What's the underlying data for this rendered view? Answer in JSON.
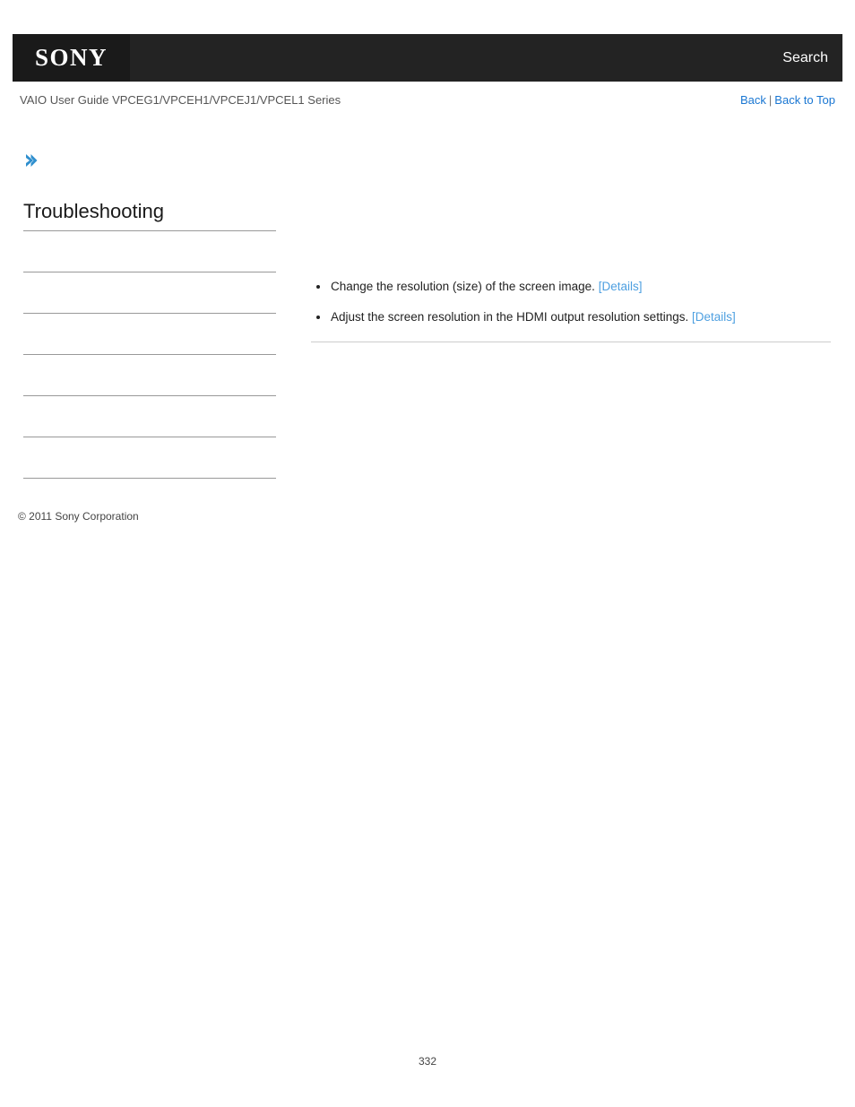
{
  "header": {
    "logo_text": "SONY",
    "search_label": "Search"
  },
  "subheader": {
    "guide_title": "VAIO User Guide VPCEG1/VPCEH1/VPCEJ1/VPCEL1 Series",
    "back_label": "Back",
    "separator": "|",
    "back_to_top_label": "Back to Top"
  },
  "sidebar": {
    "expand_icon": "chevron-right-icon",
    "section_title": "Troubleshooting",
    "items": [
      {
        "label": ""
      },
      {
        "label": ""
      },
      {
        "label": ""
      },
      {
        "label": ""
      },
      {
        "label": ""
      },
      {
        "label": ""
      }
    ],
    "copyright": "© 2011 Sony Corporation"
  },
  "main": {
    "bullets": [
      {
        "text": "Change the resolution (size) of the screen image.",
        "link_label": "[Details]"
      },
      {
        "text": "Adjust the screen resolution in the HDMI output resolution settings.",
        "link_label": "[Details]"
      }
    ]
  },
  "footer": {
    "page_number": "332"
  },
  "colors": {
    "header_background": "#232323",
    "logo_background": "#1a1a1a",
    "link_blue": "#1976d2",
    "details_blue": "#4d9fe0",
    "arrow_blue": "#2f8fce",
    "divider_gray": "#999999",
    "content_divider_gray": "#cccccc"
  }
}
